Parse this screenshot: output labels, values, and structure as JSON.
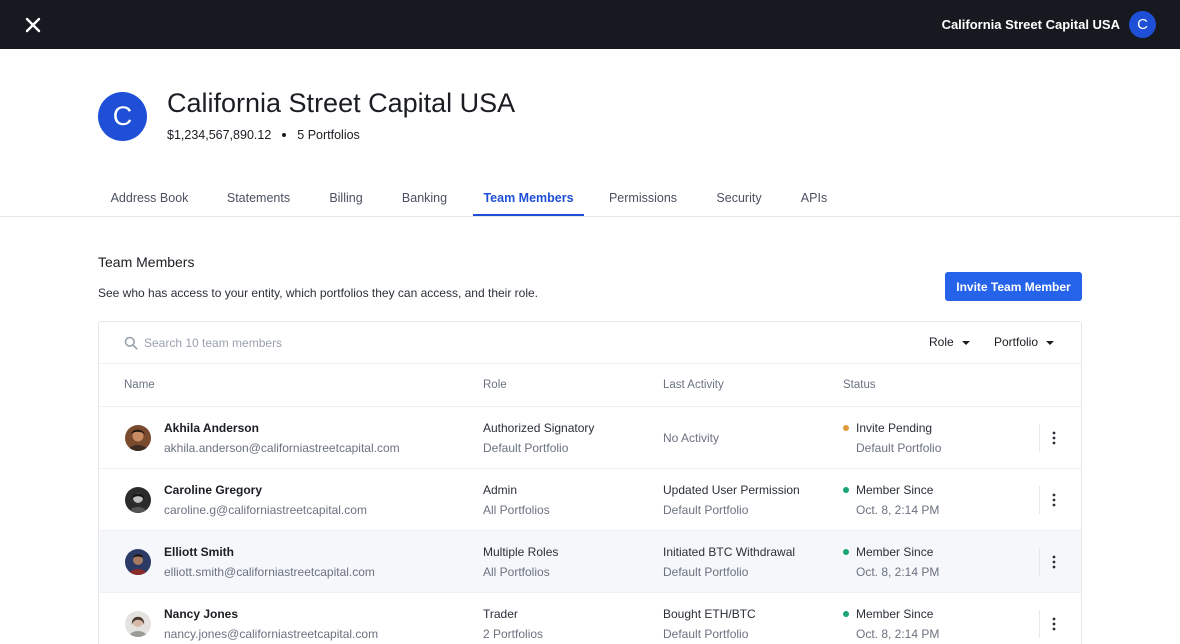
{
  "topbar": {
    "entity_name": "California Street Capital USA",
    "avatar_letter": "C"
  },
  "entity": {
    "avatar_letter": "C",
    "name": "California Street Capital USA",
    "balance": "$1,234,567,890.12",
    "portfolios": "5 Portfolios"
  },
  "tabs": [
    {
      "label": "Address Book"
    },
    {
      "label": "Statements"
    },
    {
      "label": "Billing"
    },
    {
      "label": "Banking"
    },
    {
      "label": "Team Members",
      "active": true
    },
    {
      "label": "Permissions"
    },
    {
      "label": "Security"
    },
    {
      "label": "APIs"
    }
  ],
  "section": {
    "title": "Team Members",
    "description": "See who has access to your entity, which portfolios they can access, and their role.",
    "invite_label": "Invite Team Member"
  },
  "search": {
    "placeholder": "Search 10 team members"
  },
  "filters": {
    "role_label": "Role",
    "portfolio_label": "Portfolio"
  },
  "table": {
    "headers": [
      "Name",
      "Role",
      "Last Activity",
      "Status"
    ],
    "rows": [
      {
        "name": "Akhila Anderson",
        "email": "akhila.anderson@californiastreetcapital.com",
        "role": "Authorized Signatory",
        "role_scope": "Default Portfolio",
        "activity": "No Activity",
        "activity_detail": "",
        "status": "Invite Pending",
        "status_detail": "Default Portfolio",
        "status_color": "#e09a3e"
      },
      {
        "name": "Caroline Gregory",
        "email": "caroline.g@californiastreetcapital.com",
        "role": "Admin",
        "role_scope": "All Portfolios",
        "activity": "Updated User Permission",
        "activity_detail": "Default Portfolio",
        "status": "Member Since",
        "status_detail": "Oct. 8, 2:14 PM",
        "status_color": "#1aa672"
      },
      {
        "name": "Elliott Smith",
        "email": "elliott.smith@californiastreetcapital.com",
        "role": "Multiple Roles",
        "role_scope": "All Portfolios",
        "activity": "Initiated BTC Withdrawal",
        "activity_detail": "Default Portfolio",
        "status": "Member Since",
        "status_detail": "Oct. 8, 2:14 PM",
        "status_color": "#1aa672"
      },
      {
        "name": "Nancy Jones",
        "email": "nancy.jones@californiastreetcapital.com",
        "role": "Trader",
        "role_scope": "2 Portfolios",
        "activity": "Bought ETH/BTC",
        "activity_detail": "Default Portfolio",
        "status": "Member Since",
        "status_detail": "Oct. 8, 2:14 PM",
        "status_color": "#1aa672"
      }
    ]
  },
  "colors": {
    "accent": "#1f4fd6",
    "button": "#2563eb",
    "topbar": "#16191f",
    "pending": "#e09a3e",
    "member": "#1aa672"
  }
}
